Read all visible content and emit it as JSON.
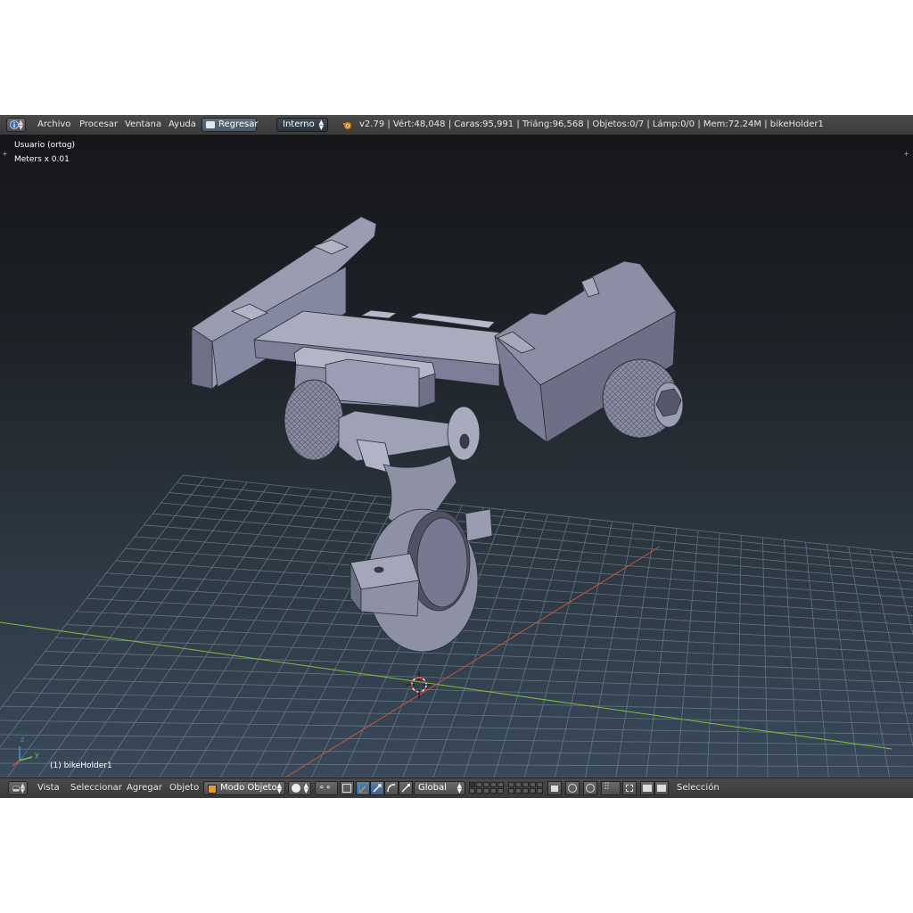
{
  "top_header": {
    "menus": [
      "Archivo",
      "Procesar",
      "Ventana",
      "Ayuda"
    ],
    "back_button": "Regresar",
    "render_engine": "Interno",
    "stats": "v2.79 | Vért:48,048 | Caras:95,991 | Triáng:96,568 | Objetos:0/7 | Lámp:0/0 | Mem:72.24M | bikeHolder1"
  },
  "viewport": {
    "view_name": "Usuario (ortog)",
    "units": "Meters x 0.01",
    "object_label": "(1) bikeHolder1",
    "axis_labels": {
      "z": "z",
      "y": "y"
    }
  },
  "bottom_header": {
    "menus": [
      "Vista",
      "Seleccionar",
      "Agregar",
      "Objeto"
    ],
    "mode": "Modo Objeto",
    "orientation": "Global",
    "selection": "Selección"
  },
  "colors": {
    "header_bg": "#424242",
    "viewport_top": "#151619",
    "viewport_bottom": "#39495a",
    "grid": "#6f8893",
    "x_axis": "#c9523a",
    "y_axis": "#7fbf3f",
    "model": "#8e90a6",
    "active_button": "#5d7ea6"
  },
  "icons": [
    "info-icon",
    "blender-logo-icon",
    "viewport-editor-icon",
    "object-mode-icon",
    "shading-icon",
    "pivot-icon",
    "manipulator-icon",
    "translate-icon",
    "rotate-icon",
    "scale-icon",
    "layer-icon",
    "lock-icon",
    "render-icon",
    "camera-icon"
  ]
}
